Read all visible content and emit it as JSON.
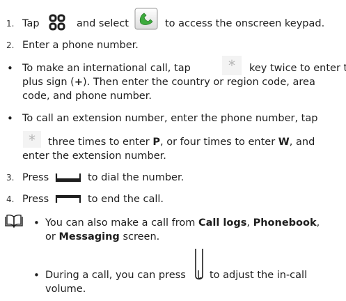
{
  "steps": {
    "s1": {
      "num": "1.",
      "a": "Tap",
      "b": "and select",
      "c": "to access the onscreen keypad."
    },
    "s2": {
      "num": "2.",
      "text": "Enter a phone number."
    },
    "s3": {
      "num": "3.",
      "a": "Press",
      "b": "to dial the number."
    },
    "s4": {
      "num": "4.",
      "a": "Press",
      "b": "to end the call."
    }
  },
  "bullets": {
    "intl": {
      "a": "To make an international call, tap",
      "b": "key twice to enter the",
      "c": "plus sign (",
      "plus": "+",
      "d": "). Then enter the country or region code, area",
      "e": "code, and phone number."
    },
    "ext": {
      "a": "To call an extension number, enter the phone number, tap",
      "b": "three times to enter",
      "p": "P",
      "c": ", or four times to enter",
      "w": "W",
      "d": ", and",
      "e": "enter the extension number."
    }
  },
  "note": {
    "icon": "book-icon",
    "b1": {
      "a": "You can also make a call from",
      "logs": "Call logs",
      "comma": ",",
      "phonebook": "Phonebook",
      "c": "or",
      "messaging": "Messaging",
      "d": "screen."
    },
    "b2": {
      "a": "During a call, you can press",
      "b": "to adjust the in-call",
      "c": "volume."
    }
  },
  "icons": {
    "grid": "grid-icon",
    "phone_app": "phone-app-icon",
    "star_key": "star-key-icon",
    "dial_key": "dial-key-icon",
    "end_key": "end-key-icon",
    "volume_key": "volume-key-icon"
  },
  "colors": {
    "phone_green": "#3daa3d",
    "star_gray": "#b5b5b5",
    "text": "#1e1e1e"
  }
}
